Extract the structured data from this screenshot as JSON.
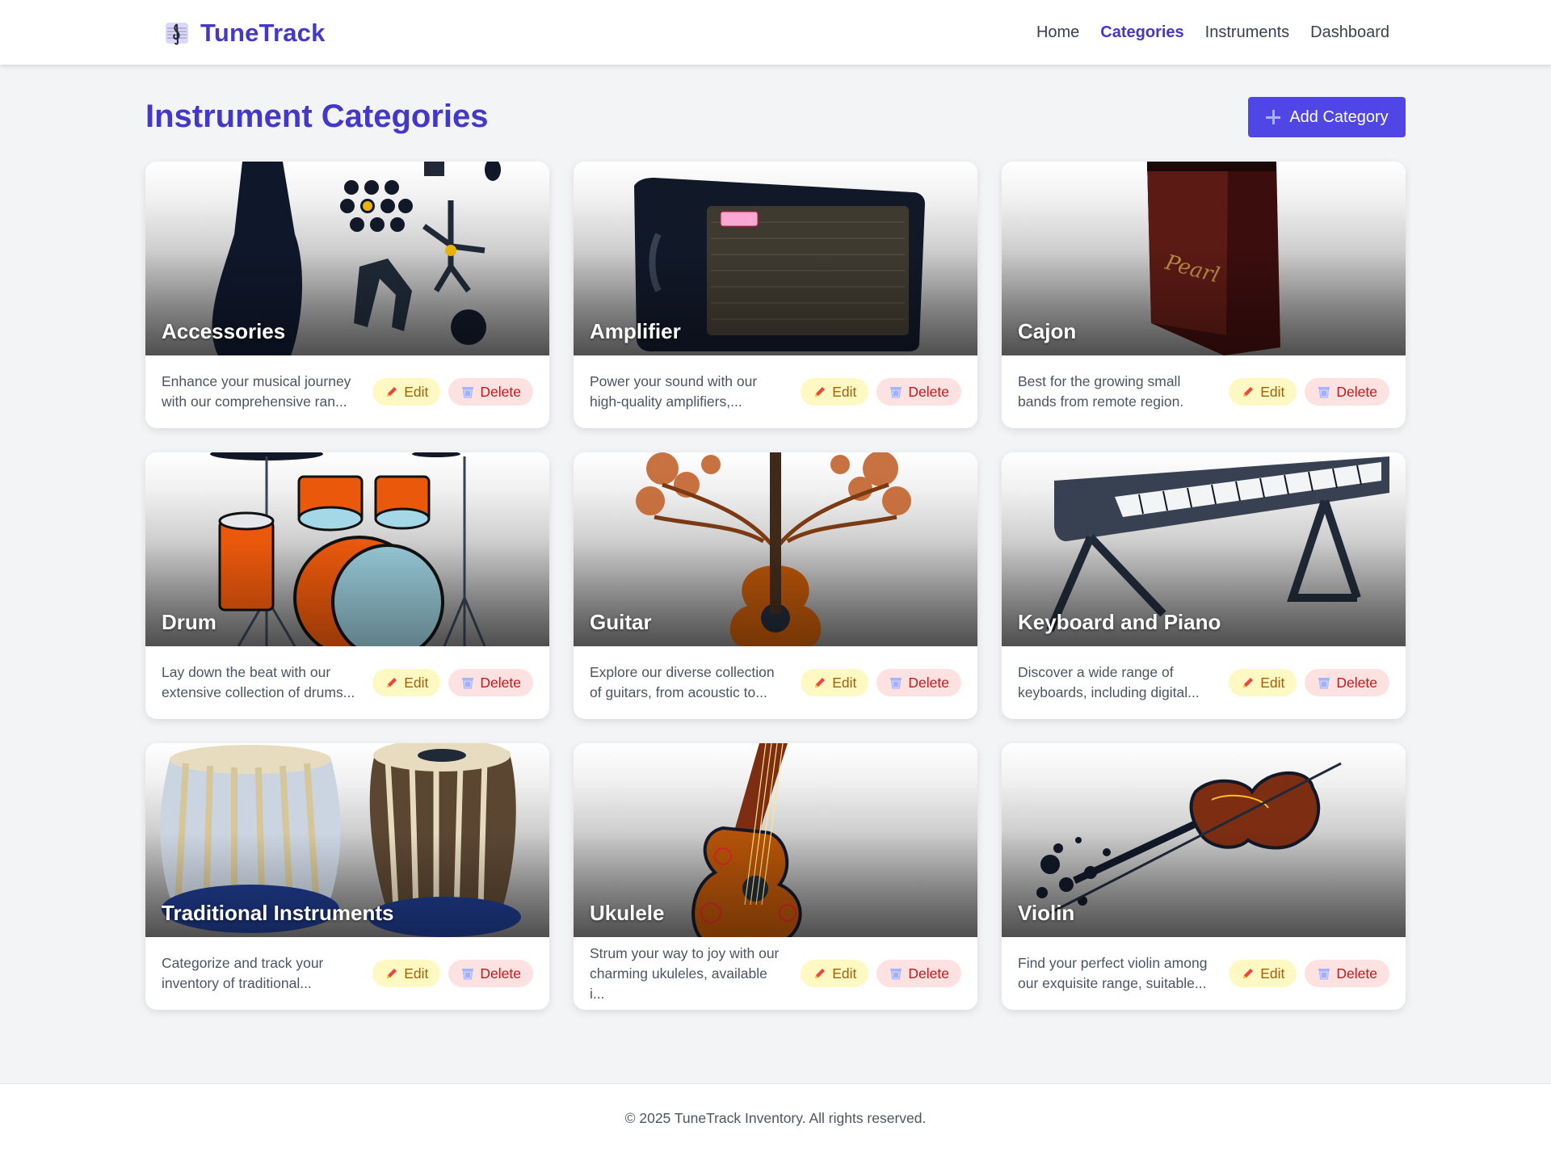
{
  "brand": {
    "name": "TuneTrack",
    "logo_icon": "music-note-icon"
  },
  "nav": {
    "items": [
      {
        "label": "Home",
        "active": false
      },
      {
        "label": "Categories",
        "active": true
      },
      {
        "label": "Instruments",
        "active": false
      },
      {
        "label": "Dashboard",
        "active": false
      }
    ]
  },
  "page": {
    "title": "Instrument Categories",
    "add_button_label": "Add Category",
    "add_button_icon": "plus-icon"
  },
  "categories": [
    {
      "name": "Accessories",
      "description": "Enhance your musical journey with our comprehensive ran...",
      "image_icon": "guitar-accessories-icon"
    },
    {
      "name": "Amplifier",
      "description": "Power your sound with our high-quality amplifiers,...",
      "image_icon": "amplifier-icon"
    },
    {
      "name": "Cajon",
      "description": "Best for the growing small bands from remote region.",
      "image_icon": "cajon-icon"
    },
    {
      "name": "Drum",
      "description": "Lay down the beat with our extensive collection of drums...",
      "image_icon": "drum-kit-icon"
    },
    {
      "name": "Guitar",
      "description": "Explore our diverse collection of guitars, from acoustic to...",
      "image_icon": "guitar-icon"
    },
    {
      "name": "Keyboard and Piano",
      "description": "Discover a wide range of keyboards, including digital...",
      "image_icon": "keyboard-icon"
    },
    {
      "name": "Traditional Instruments",
      "description": "Categorize and track your inventory of traditional...",
      "image_icon": "tabla-icon"
    },
    {
      "name": "Ukulele",
      "description": "Strum your way to joy with our charming ukuleles, available i...",
      "image_icon": "ukulele-icon"
    },
    {
      "name": "Violin",
      "description": "Find your perfect violin among our exquisite range, suitable...",
      "image_icon": "violin-icon"
    }
  ],
  "actions": {
    "edit_label": "Edit",
    "edit_icon": "pencil-icon",
    "delete_label": "Delete",
    "delete_icon": "trash-icon"
  },
  "footer": {
    "text": "© 2025 TuneTrack Inventory. All rights reserved."
  },
  "colors": {
    "brand": "#4338ca",
    "primary_button": "#4f46e5",
    "edit_bg": "#fef9c3",
    "edit_text": "#a16207",
    "delete_bg": "#fee2e2",
    "delete_text": "#b91c1c",
    "page_bg": "#f3f4f6"
  }
}
